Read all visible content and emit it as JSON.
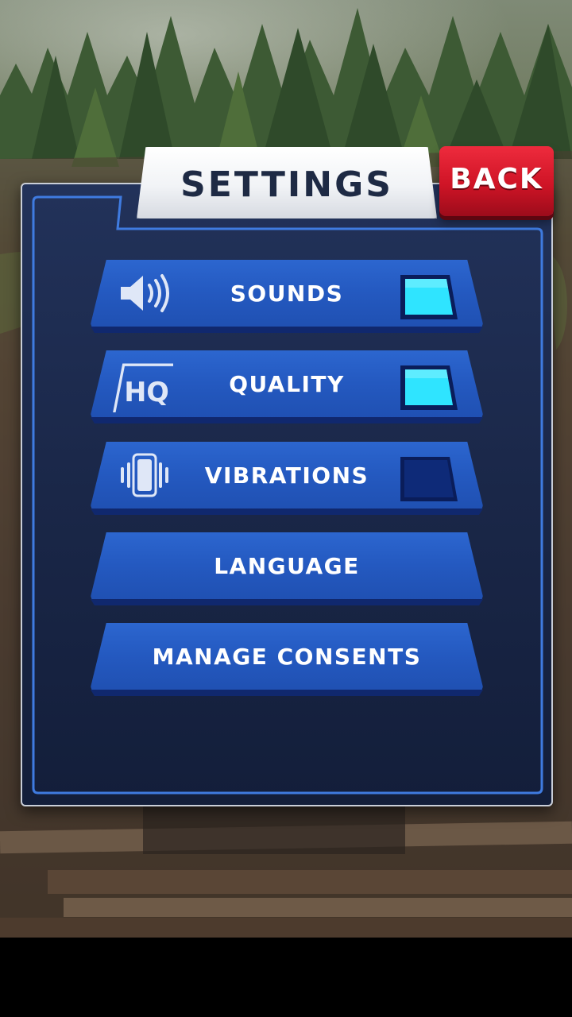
{
  "header": {
    "title": "SETTINGS",
    "back_label": "BACK"
  },
  "settings": {
    "rows": [
      {
        "label": "SOUNDS",
        "icon": "speaker-icon",
        "toggle": true
      },
      {
        "label": "QUALITY",
        "icon": "hq-icon",
        "icon_text": "HQ",
        "toggle": true
      },
      {
        "label": "VIBRATIONS",
        "icon": "vibration-icon",
        "toggle": false
      }
    ],
    "buttons": [
      {
        "label": "LANGUAGE"
      },
      {
        "label": "MANAGE CONSENTS"
      }
    ]
  },
  "colors": {
    "toggle_on": "#2fe4ff",
    "toggle_off": "#0e2a78",
    "row_blue": "#2459c0",
    "back_red": "#cf1426",
    "panel_navy": "#1a2748"
  }
}
